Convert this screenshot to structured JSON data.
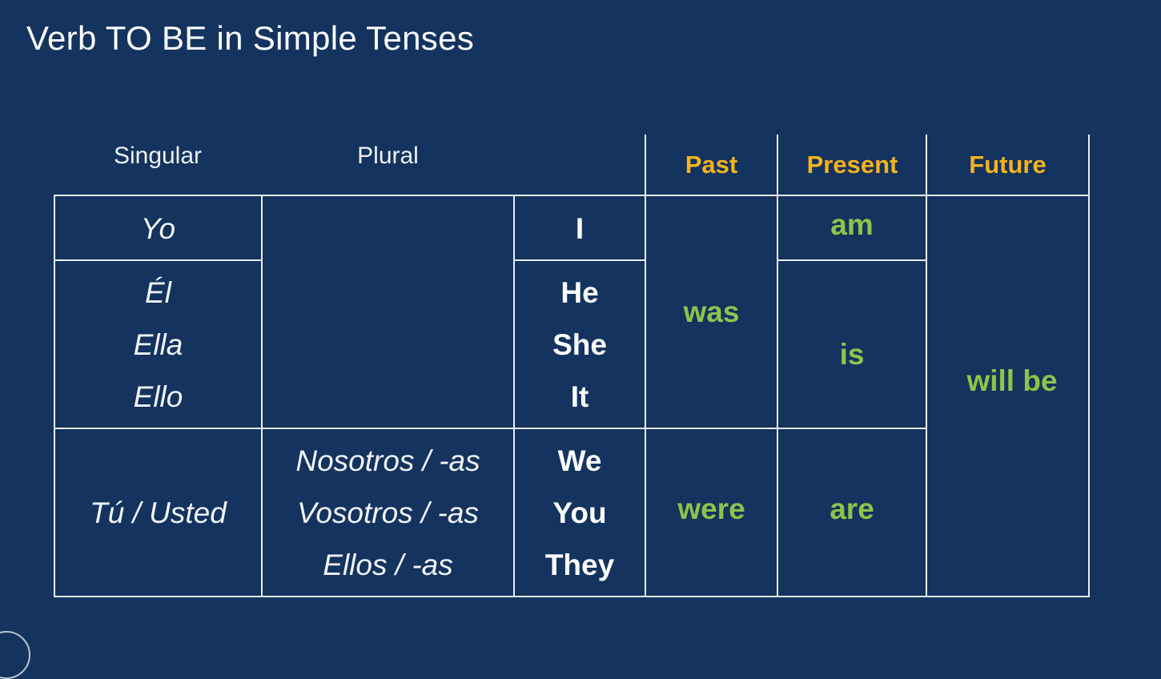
{
  "title": "Verb TO BE in Simple Tenses",
  "headers": {
    "singular": "Singular",
    "plural": "Plural",
    "past": "Past",
    "present": "Present",
    "future": "Future"
  },
  "rows": {
    "first": {
      "singular": [
        "Yo"
      ],
      "english": [
        "I"
      ],
      "present": "am"
    },
    "third": {
      "singular": [
        "Él",
        "Ella",
        "Ello"
      ],
      "english": [
        "He",
        "She",
        "It"
      ],
      "present": "is"
    },
    "plural": {
      "singular": [
        "Tú / Usted"
      ],
      "plural": [
        "Nosotros / -as",
        "Vosotros / -as",
        "Ellos / -as"
      ],
      "english": [
        "We",
        "You",
        "They"
      ],
      "past": "were",
      "present": "are"
    }
  },
  "past_singular": "was",
  "future_all": "will be",
  "colors": {
    "background": "#14335e",
    "tense_header": "#f5b31c",
    "verb": "#8dc44b",
    "lines": "#e9eef5"
  }
}
